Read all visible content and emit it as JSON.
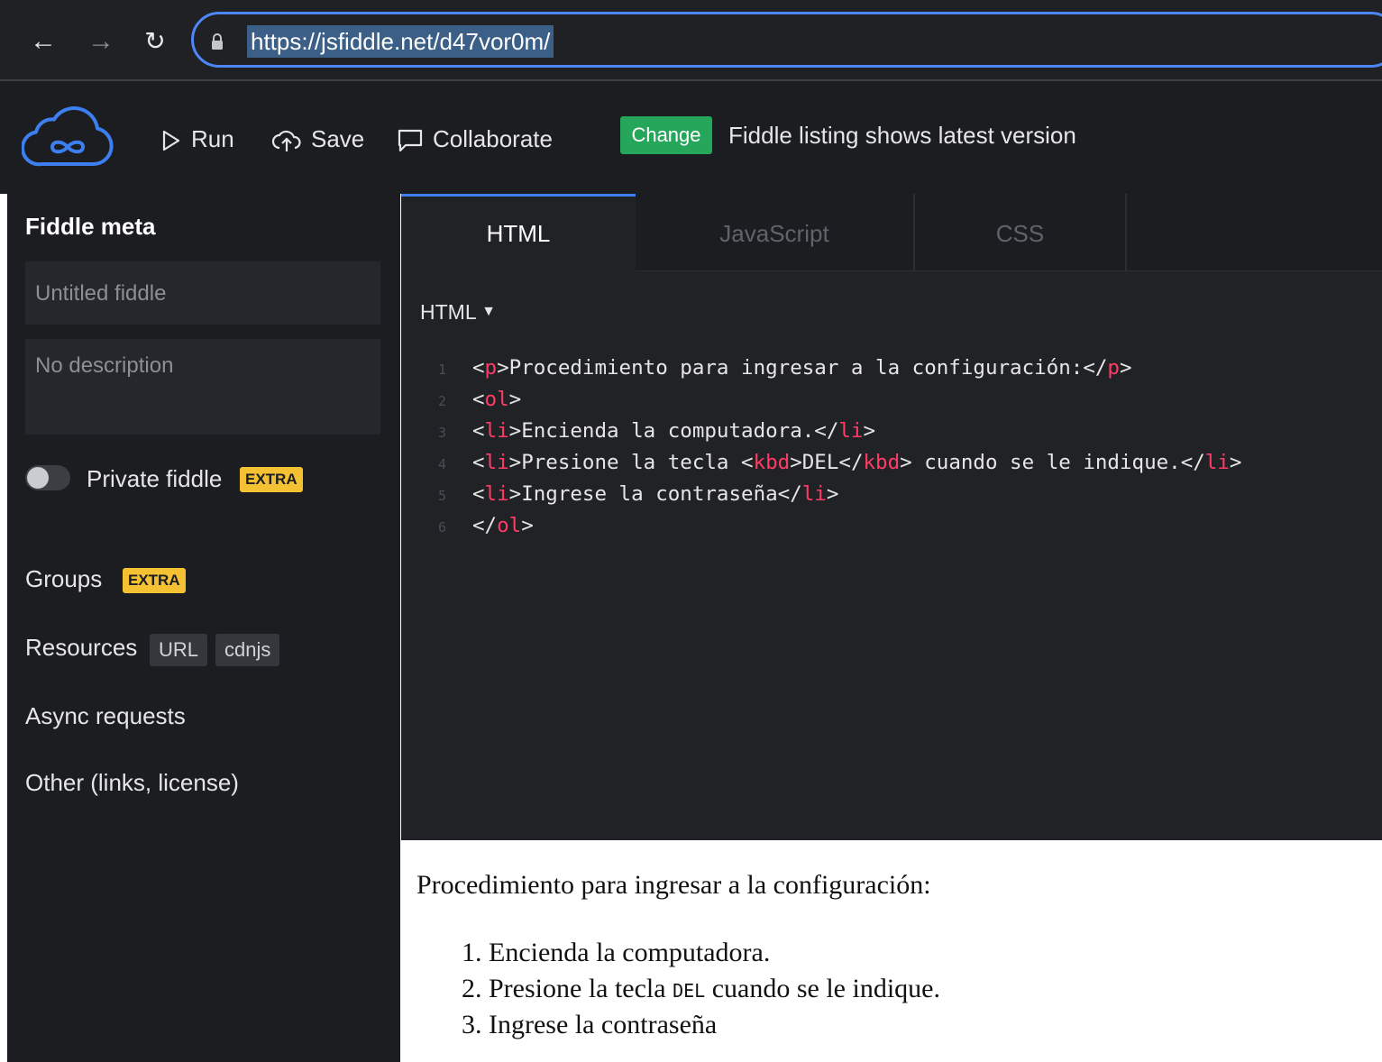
{
  "browser": {
    "url": "https://jsfiddle.net/d47vor0m/"
  },
  "header": {
    "run_label": "Run",
    "save_label": "Save",
    "collaborate_label": "Collaborate",
    "change_label": "Change",
    "listing_text": "Fiddle listing shows latest version"
  },
  "sidebar": {
    "title": "Fiddle meta",
    "title_placeholder": "Untitled fiddle",
    "description_placeholder": "No description",
    "private_label": "Private fiddle",
    "private_badge": "EXTRA",
    "private_enabled": false,
    "groups_label": "Groups",
    "groups_badge": "EXTRA",
    "resources_label": "Resources",
    "resources_url": "URL",
    "resources_cdnjs": "cdnjs",
    "async_label": "Async requests",
    "other_label": "Other (links, license)"
  },
  "tabs": {
    "html": "HTML",
    "javascript": "JavaScript",
    "css": "CSS"
  },
  "editor": {
    "language": "HTML",
    "lines": [
      {
        "n": "1",
        "code": "<p>Procedimiento para ingresar a la configuración:</p>"
      },
      {
        "n": "2",
        "code": "<ol>"
      },
      {
        "n": "3",
        "code": "<li>Encienda la computadora.</li>"
      },
      {
        "n": "4",
        "code": "<li>Presione la tecla <kbd>DEL</kbd> cuando se le indique.</li>"
      },
      {
        "n": "5",
        "code": "<li>Ingrese la contraseña</li>"
      },
      {
        "n": "6",
        "code": "</ol>"
      }
    ]
  },
  "result": {
    "paragraph": "Procedimiento para ingresar a la configuración:",
    "items": [
      {
        "num": "1.",
        "text": "Encienda la computadora."
      },
      {
        "num": "2.",
        "before": "Presione la tecla",
        "kbd": "DEL",
        "after": "cuando se le indique."
      },
      {
        "num": "3.",
        "text": "Ingrese la contraseña"
      }
    ]
  },
  "colors": {
    "accent_blue": "#3d7ef0",
    "change_green": "#26a65b",
    "extra_yellow": "#f3c131",
    "code_tag": "#ff3b66"
  }
}
